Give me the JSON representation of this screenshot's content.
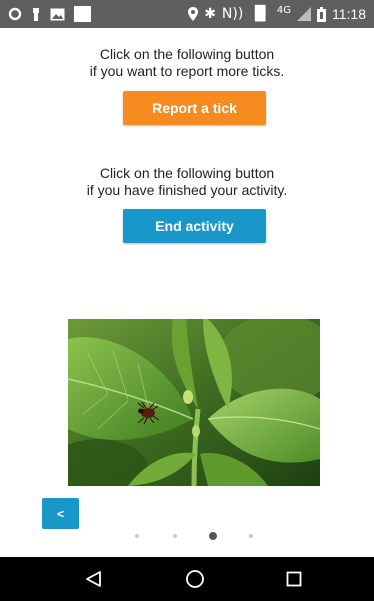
{
  "status_bar": {
    "time": "11:18",
    "network": "4G",
    "left_icons": [
      "circle-icon",
      "person-icon",
      "image-icon",
      "white-square-icon"
    ],
    "right_icons": [
      "location-icon",
      "bluetooth-icon",
      "nfc-icon",
      "vibrate-icon",
      "signal-icon",
      "battery-icon"
    ]
  },
  "content": {
    "report_message_line1": "Click on the following button",
    "report_message_line2": "if you want to report more ticks.",
    "report_button_label": "Report a tick",
    "end_message_line1": "Click on the following button",
    "end_message_line2": "if you have finished your activity.",
    "end_button_label": "End activity"
  },
  "back_button_label": "<",
  "pager": {
    "total": 4,
    "active_index": 2
  },
  "colors": {
    "report_button": "#f68b1f",
    "end_button": "#1a97c9",
    "back_button": "#1a97c9",
    "status_bar": "#5f5f5f",
    "nav_bar": "#000000"
  },
  "nav_bar": {
    "icons": [
      "back-triangle-icon",
      "home-circle-icon",
      "recents-square-icon"
    ]
  }
}
